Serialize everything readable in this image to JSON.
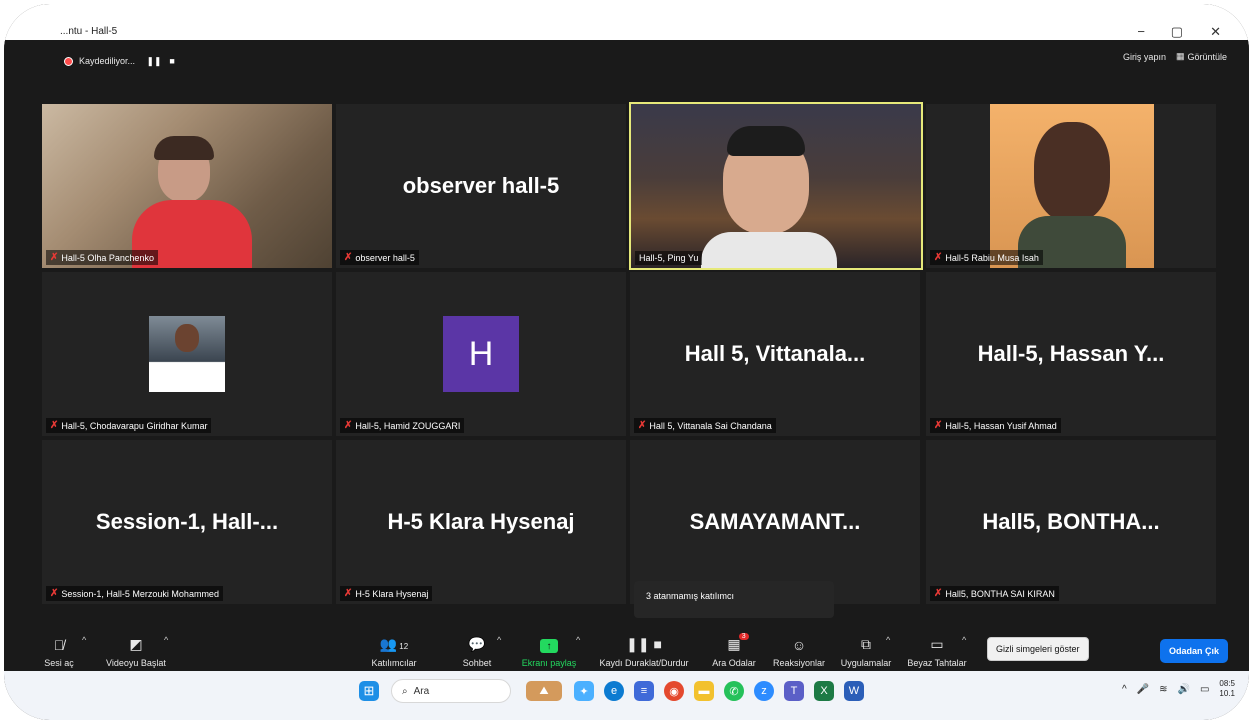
{
  "window": {
    "title": "...ntu - Hall-5",
    "minimize": "−",
    "maximize": "▢",
    "close": "✕"
  },
  "recording": {
    "label": "Kaydediliyor...",
    "pause_icon": "❚❚",
    "stop_icon": "■"
  },
  "topbar": {
    "signin": "Giriş yapın",
    "view": "Görüntüle"
  },
  "tiles": [
    {
      "name": "Hall-5 Olha Panchenko",
      "big": ""
    },
    {
      "name": "observer hall-5",
      "big": "observer hall-5"
    },
    {
      "name": "Hall-5, Ping Yu",
      "big": ""
    },
    {
      "name": "Hall-5 Rabiu Musa Isah",
      "big": ""
    },
    {
      "name": "Hall-5, Chodavarapu Giridhar Kumar",
      "big": ""
    },
    {
      "name": "Hall-5, Hamid ZOUGGARI",
      "big": "H"
    },
    {
      "name": "Hall 5, Vittanala Sai Chandana",
      "big": "Hall 5,  Vittanala..."
    },
    {
      "name": "Hall-5, Hassan Yusif Ahmad",
      "big": "Hall-5,  Hassan Y..."
    },
    {
      "name": "Session-1, Hall-5 Merzouki Mohammed",
      "big": "Session-1,  Hall-..."
    },
    {
      "name": "H-5 Klara Hysenaj",
      "big": "H-5 Klara Hysenaj"
    },
    {
      "name": "",
      "big": "SAMAYAMANT..."
    },
    {
      "name": "Hall5, BONTHA SAI KIRAN",
      "big": "Hall5,  BONTHA..."
    }
  ],
  "tooltip": "3 atanmamış katılımcı",
  "toolbar": {
    "audio": "Sesi aç",
    "video": "Videoyu Başlat",
    "participants": "Katılımcılar",
    "participants_count": "12",
    "chat": "Sohbet",
    "share": "Ekranı paylaş",
    "recording": "Kaydı Duraklat/Durdur",
    "breakout": "Ara Odalar",
    "breakout_badge": "3",
    "reactions": "Reaksiyonlar",
    "apps": "Uygulamalar",
    "whiteboard": "Beyaz Tahtalar",
    "show_hidden": "Gizli simgeleri göster",
    "leave": "Odadan Çık"
  },
  "taskbar": {
    "search": "Ara",
    "time": "08:5",
    "date": "10.1"
  },
  "colors": {
    "active_speaker": "#e6e97a",
    "share_green": "#23d95f",
    "leave_blue": "#0e72ed",
    "mute_red": "#e53935"
  }
}
